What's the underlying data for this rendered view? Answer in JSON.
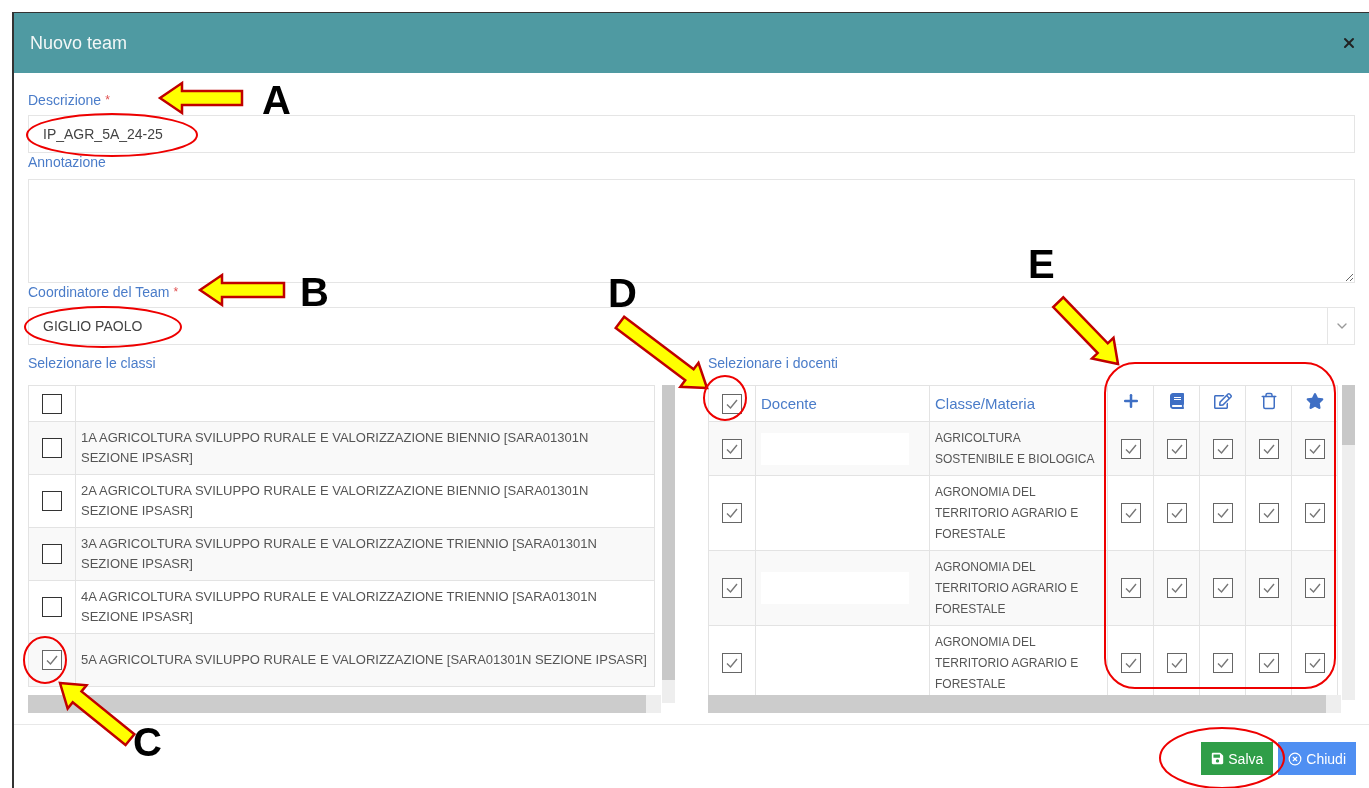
{
  "window": {
    "title": "Nuovo team"
  },
  "fields": [
    {
      "kind": "text",
      "label": "Descrizione",
      "required_mark": "*",
      "value": "IP_AGR_5A_24-25"
    },
    {
      "kind": "textarea",
      "label": "Annotazione"
    },
    {
      "kind": "select",
      "label": "Coordinatore del Team",
      "required_mark": "*",
      "value": "GIGLIO PAOLO"
    }
  ],
  "classes": {
    "title": "Selezionare le classi",
    "all_checked": false,
    "rows": [
      {
        "name": "1A AGRICOLTURA SVILUPPO RURALE E VALORIZZAZIONE BIENNIO [SARA01301N SEZIONE IPSASR]",
        "checked": false
      },
      {
        "name": "2A AGRICOLTURA SVILUPPO RURALE E VALORIZZAZIONE BIENNIO [SARA01301N SEZIONE IPSASR]",
        "checked": false
      },
      {
        "name": "3A AGRICOLTURA SVILUPPO RURALE E VALORIZZAZIONE TRIENNIO [SARA01301N SEZIONE IPSASR]",
        "checked": false
      },
      {
        "name": "4A AGRICOLTURA SVILUPPO RURALE E VALORIZZAZIONE TRIENNIO [SARA01301N SEZIONE IPSASR]",
        "checked": false
      },
      {
        "name": "5A AGRICOLTURA SVILUPPO RURALE E VALORIZZAZIONE [SARA01301N SEZIONE IPSASR]",
        "checked": true
      }
    ]
  },
  "teachers": {
    "title": "Selezionare i docenti",
    "all_checked": true,
    "columns": [
      "Docente",
      "Classe/Materia"
    ],
    "permission_columns": [
      {
        "kind": "add"
      },
      {
        "kind": "book"
      },
      {
        "kind": "edit"
      },
      {
        "kind": "delete"
      },
      {
        "kind": "star"
      }
    ],
    "rows": [
      {
        "checked": true,
        "subject": "AGRICOLTURA SOSTENIBILE E BIOLOGICA",
        "permissions": [
          {
            "checked": true
          },
          {
            "checked": true
          },
          {
            "checked": true
          },
          {
            "checked": true
          },
          {
            "checked": true
          }
        ]
      },
      {
        "checked": true,
        "subject": "AGRONOMIA DEL TERRITORIO AGRARIO E FORESTALE",
        "permissions": [
          {
            "checked": true
          },
          {
            "checked": true
          },
          {
            "checked": true
          },
          {
            "checked": true
          },
          {
            "checked": true
          }
        ]
      },
      {
        "checked": true,
        "subject": "AGRONOMIA DEL TERRITORIO AGRARIO E FORESTALE",
        "permissions": [
          {
            "checked": true
          },
          {
            "checked": true
          },
          {
            "checked": true
          },
          {
            "checked": true
          },
          {
            "checked": true
          }
        ]
      },
      {
        "checked": true,
        "subject": "AGRONOMIA DEL TERRITORIO AGRARIO E FORESTALE",
        "permissions": [
          {
            "checked": true
          },
          {
            "checked": true
          },
          {
            "checked": true
          },
          {
            "checked": true
          },
          {
            "checked": true
          }
        ]
      }
    ]
  },
  "buttons": [
    {
      "kind": "save",
      "label": "Salva"
    },
    {
      "kind": "close",
      "label": "Chiudi"
    }
  ],
  "annotations": [
    {
      "label": "A"
    },
    {
      "label": "B"
    },
    {
      "label": "C"
    },
    {
      "label": "D"
    },
    {
      "label": "E"
    }
  ]
}
